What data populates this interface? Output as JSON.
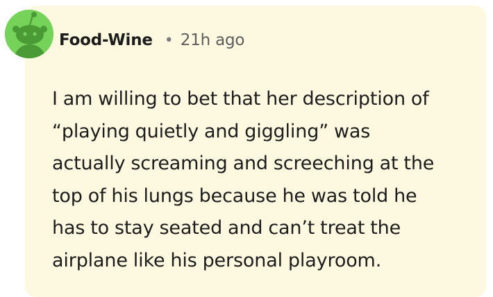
{
  "comment": {
    "author": "Food-Wine",
    "separator": "•",
    "timestamp": "21h ago",
    "avatar_icon": "snoo-avatar-icon",
    "colors": {
      "background": "#fdf8e0",
      "avatar": "#76d35a",
      "text": "#1c1c1c",
      "meta": "#5c5c5c"
    },
    "body_lines": [
      "I am willing to bet that her description of",
      "“playing quietly and giggling” was",
      "actually screaming and screeching at the",
      "top of his lungs because he was told he",
      "has to stay seated and can’t treat the",
      "airplane like his personal playroom."
    ]
  }
}
